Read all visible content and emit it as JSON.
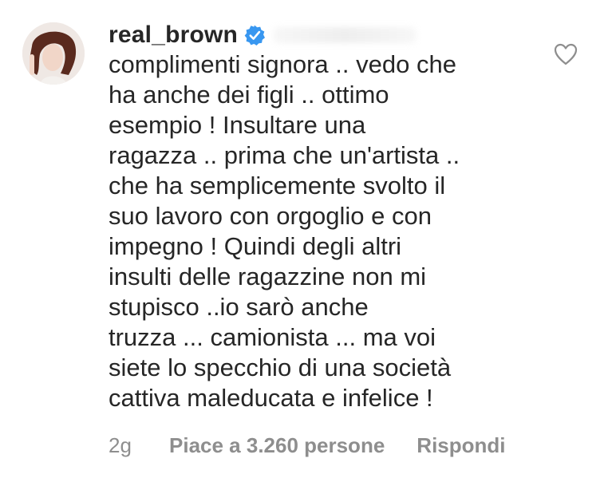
{
  "comment": {
    "username": "real_brown",
    "text": "complimenti signora .. vedo che\nha anche dei figli .. ottimo\nesempio ! Insultare una\nragazza .. prima che un'artista ..\nche ha semplicemente svolto il\nsuo lavoro con orgoglio e con\nimpegno ! Quindi degli altri\ninsulti delle ragazzine non mi\nstupisco ..io sarò anche\ntruzza ... camionista ... ma voi\nsiete lo specchio di una società\ncattiva maleducata e infelice !",
    "time": "2g",
    "likes": "Piace a 3.260 persone",
    "reply": "Rispondi"
  },
  "icons": {
    "verified": "verified-badge-icon",
    "like": "heart-outline-icon"
  },
  "colors": {
    "text": "#262626",
    "meta": "#8e8e8e",
    "verified": "#3897f0"
  }
}
